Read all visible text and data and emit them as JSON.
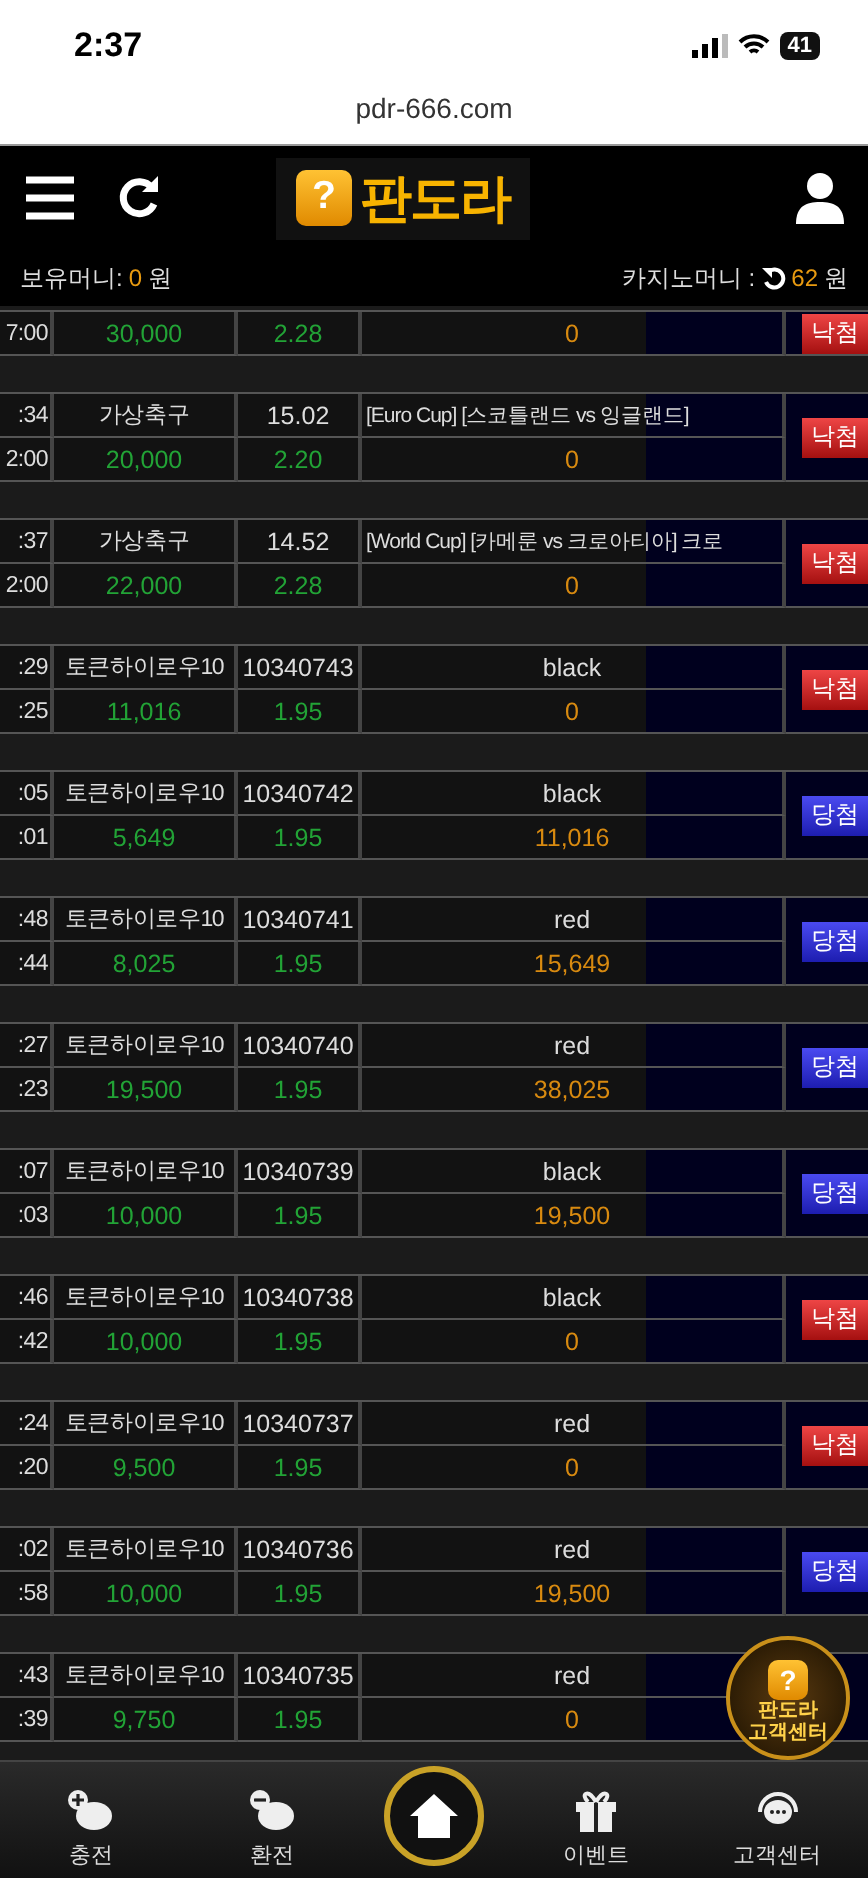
{
  "status_bar": {
    "time": "2:37",
    "battery": "41"
  },
  "url_bar": {
    "address": "pdr-666.com"
  },
  "header": {
    "logo_mark": "?",
    "logo": "판도라"
  },
  "balance_bar": {
    "holding_label": "보유머니:",
    "holding_value": "0",
    "holding_unit": "원",
    "casino_label": "카지노머니 :",
    "casino_value": "62",
    "casino_unit": "원"
  },
  "bets": [
    {
      "bottom": {
        "time": "7:00",
        "amount": "30,000",
        "odds": "2.28",
        "payout": "0"
      },
      "result": {
        "kind": "lose",
        "label": "낙첨"
      }
    },
    {
      "top": {
        "kind": "match",
        "time": ":34",
        "game": "가상축구",
        "round": "15.02",
        "pick": "[Euro Cup] [스코틀랜드 vs 잉글랜드]"
      },
      "bottom": {
        "time": "2:00",
        "amount": "20,000",
        "odds": "2.20",
        "payout": "0"
      },
      "result": {
        "kind": "lose",
        "label": "낙첨"
      }
    },
    {
      "top": {
        "kind": "match",
        "time": ":37",
        "game": "가상축구",
        "round": "14.52",
        "pick": "[World Cup] [카메룬 vs 크로아티아] 크로"
      },
      "bottom": {
        "time": "2:00",
        "amount": "22,000",
        "odds": "2.28",
        "payout": "0"
      },
      "result": {
        "kind": "lose",
        "label": "낙첨"
      }
    },
    {
      "top": {
        "kind": "token",
        "time": ":29",
        "game": "토큰하이로우10",
        "round": "10340743",
        "pick": "black"
      },
      "bottom": {
        "time": ":25",
        "amount": "11,016",
        "odds": "1.95",
        "payout": "0"
      },
      "result": {
        "kind": "lose",
        "label": "낙첨"
      }
    },
    {
      "top": {
        "kind": "token",
        "time": ":05",
        "game": "토큰하이로우10",
        "round": "10340742",
        "pick": "black"
      },
      "bottom": {
        "time": ":01",
        "amount": "5,649",
        "odds": "1.95",
        "payout": "11,016"
      },
      "result": {
        "kind": "win",
        "label": "당첨"
      }
    },
    {
      "top": {
        "kind": "token",
        "time": ":48",
        "game": "토큰하이로우10",
        "round": "10340741",
        "pick": "red"
      },
      "bottom": {
        "time": ":44",
        "amount": "8,025",
        "odds": "1.95",
        "payout": "15,649"
      },
      "result": {
        "kind": "win",
        "label": "당첨"
      }
    },
    {
      "top": {
        "kind": "token",
        "time": ":27",
        "game": "토큰하이로우10",
        "round": "10340740",
        "pick": "red"
      },
      "bottom": {
        "time": ":23",
        "amount": "19,500",
        "odds": "1.95",
        "payout": "38,025"
      },
      "result": {
        "kind": "win",
        "label": "당첨"
      }
    },
    {
      "top": {
        "kind": "token",
        "time": ":07",
        "game": "토큰하이로우10",
        "round": "10340739",
        "pick": "black"
      },
      "bottom": {
        "time": ":03",
        "amount": "10,000",
        "odds": "1.95",
        "payout": "19,500"
      },
      "result": {
        "kind": "win",
        "label": "당첨"
      }
    },
    {
      "top": {
        "kind": "token",
        "time": ":46",
        "game": "토큰하이로우10",
        "round": "10340738",
        "pick": "black"
      },
      "bottom": {
        "time": ":42",
        "amount": "10,000",
        "odds": "1.95",
        "payout": "0"
      },
      "result": {
        "kind": "lose",
        "label": "낙첨"
      }
    },
    {
      "top": {
        "kind": "token",
        "time": ":24",
        "game": "토큰하이로우10",
        "round": "10340737",
        "pick": "red"
      },
      "bottom": {
        "time": ":20",
        "amount": "9,500",
        "odds": "1.95",
        "payout": "0"
      },
      "result": {
        "kind": "lose",
        "label": "낙첨"
      }
    },
    {
      "top": {
        "kind": "token",
        "time": ":02",
        "game": "토큰하이로우10",
        "round": "10340736",
        "pick": "red"
      },
      "bottom": {
        "time": ":58",
        "amount": "10,000",
        "odds": "1.95",
        "payout": "19,500"
      },
      "result": {
        "kind": "win",
        "label": "당첨"
      }
    },
    {
      "top": {
        "kind": "token",
        "time": ":43",
        "game": "토큰하이로우10",
        "round": "10340735",
        "pick": "red"
      },
      "bottom": {
        "time": ":39",
        "amount": "9,750",
        "odds": "1.95",
        "payout": "0"
      }
    }
  ],
  "support_badge": {
    "mark": "?",
    "title": "판도라",
    "subtitle": "고객센터"
  },
  "bottom_nav": [
    {
      "kind": "deposit",
      "label": "충전"
    },
    {
      "kind": "withdraw",
      "label": "환전"
    },
    {
      "kind": "home"
    },
    {
      "kind": "event",
      "label": "이벤트"
    },
    {
      "kind": "support",
      "label": "고객센터"
    }
  ]
}
